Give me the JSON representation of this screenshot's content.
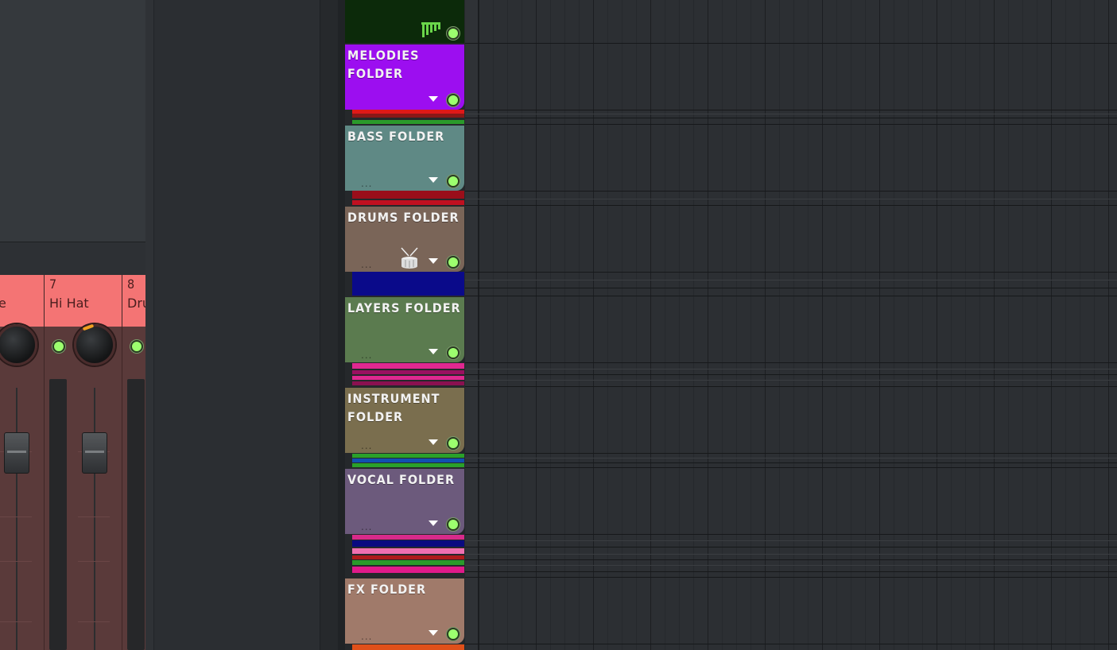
{
  "mixer": {
    "channels": [
      {
        "number": "",
        "name": "e"
      },
      {
        "number": "7",
        "name": "Hi Hat"
      },
      {
        "number": "8",
        "name": "Dru"
      }
    ]
  },
  "folders": [
    {
      "title": "MELODIES FOLDER",
      "color": "#9c0ef0"
    },
    {
      "title": "BASS FOLDER",
      "color": "#5f8985",
      "dots": "..."
    },
    {
      "title": "DRUMS FOLDER",
      "color": "#7a6558",
      "dots": "...",
      "icon": "drum-icon"
    },
    {
      "title": "LAYERS FOLDER",
      "color": "#5b7b4f",
      "dots": "..."
    },
    {
      "title": "INSTRUMENT FOLDER",
      "color": "#7a6e4e",
      "dots": "..."
    },
    {
      "title": "VOCAL FOLDER",
      "color": "#6c5a7c",
      "dots": "..."
    },
    {
      "title": "FX FOLDER",
      "color": "#a07a6a",
      "dots": "..."
    }
  ],
  "top_track": {
    "icon": "panpipe-icon",
    "color": "#0c2a0a"
  },
  "colors": {
    "mixer_header": "#f47474",
    "mixer_body": "#5a3a3a",
    "led": "#9cff6e",
    "playlist_bg": "#2c2f33"
  }
}
